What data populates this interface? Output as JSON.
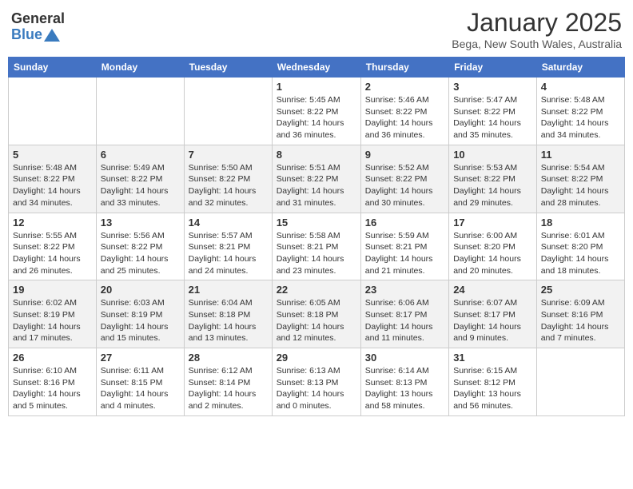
{
  "header": {
    "logo_general": "General",
    "logo_blue": "Blue",
    "month": "January 2025",
    "location": "Bega, New South Wales, Australia"
  },
  "weekdays": [
    "Sunday",
    "Monday",
    "Tuesday",
    "Wednesday",
    "Thursday",
    "Friday",
    "Saturday"
  ],
  "weeks": [
    [
      {
        "day": "",
        "info": ""
      },
      {
        "day": "",
        "info": ""
      },
      {
        "day": "",
        "info": ""
      },
      {
        "day": "1",
        "info": "Sunrise: 5:45 AM\nSunset: 8:22 PM\nDaylight: 14 hours\nand 36 minutes."
      },
      {
        "day": "2",
        "info": "Sunrise: 5:46 AM\nSunset: 8:22 PM\nDaylight: 14 hours\nand 36 minutes."
      },
      {
        "day": "3",
        "info": "Sunrise: 5:47 AM\nSunset: 8:22 PM\nDaylight: 14 hours\nand 35 minutes."
      },
      {
        "day": "4",
        "info": "Sunrise: 5:48 AM\nSunset: 8:22 PM\nDaylight: 14 hours\nand 34 minutes."
      }
    ],
    [
      {
        "day": "5",
        "info": "Sunrise: 5:48 AM\nSunset: 8:22 PM\nDaylight: 14 hours\nand 34 minutes."
      },
      {
        "day": "6",
        "info": "Sunrise: 5:49 AM\nSunset: 8:22 PM\nDaylight: 14 hours\nand 33 minutes."
      },
      {
        "day": "7",
        "info": "Sunrise: 5:50 AM\nSunset: 8:22 PM\nDaylight: 14 hours\nand 32 minutes."
      },
      {
        "day": "8",
        "info": "Sunrise: 5:51 AM\nSunset: 8:22 PM\nDaylight: 14 hours\nand 31 minutes."
      },
      {
        "day": "9",
        "info": "Sunrise: 5:52 AM\nSunset: 8:22 PM\nDaylight: 14 hours\nand 30 minutes."
      },
      {
        "day": "10",
        "info": "Sunrise: 5:53 AM\nSunset: 8:22 PM\nDaylight: 14 hours\nand 29 minutes."
      },
      {
        "day": "11",
        "info": "Sunrise: 5:54 AM\nSunset: 8:22 PM\nDaylight: 14 hours\nand 28 minutes."
      }
    ],
    [
      {
        "day": "12",
        "info": "Sunrise: 5:55 AM\nSunset: 8:22 PM\nDaylight: 14 hours\nand 26 minutes."
      },
      {
        "day": "13",
        "info": "Sunrise: 5:56 AM\nSunset: 8:22 PM\nDaylight: 14 hours\nand 25 minutes."
      },
      {
        "day": "14",
        "info": "Sunrise: 5:57 AM\nSunset: 8:21 PM\nDaylight: 14 hours\nand 24 minutes."
      },
      {
        "day": "15",
        "info": "Sunrise: 5:58 AM\nSunset: 8:21 PM\nDaylight: 14 hours\nand 23 minutes."
      },
      {
        "day": "16",
        "info": "Sunrise: 5:59 AM\nSunset: 8:21 PM\nDaylight: 14 hours\nand 21 minutes."
      },
      {
        "day": "17",
        "info": "Sunrise: 6:00 AM\nSunset: 8:20 PM\nDaylight: 14 hours\nand 20 minutes."
      },
      {
        "day": "18",
        "info": "Sunrise: 6:01 AM\nSunset: 8:20 PM\nDaylight: 14 hours\nand 18 minutes."
      }
    ],
    [
      {
        "day": "19",
        "info": "Sunrise: 6:02 AM\nSunset: 8:19 PM\nDaylight: 14 hours\nand 17 minutes."
      },
      {
        "day": "20",
        "info": "Sunrise: 6:03 AM\nSunset: 8:19 PM\nDaylight: 14 hours\nand 15 minutes."
      },
      {
        "day": "21",
        "info": "Sunrise: 6:04 AM\nSunset: 8:18 PM\nDaylight: 14 hours\nand 13 minutes."
      },
      {
        "day": "22",
        "info": "Sunrise: 6:05 AM\nSunset: 8:18 PM\nDaylight: 14 hours\nand 12 minutes."
      },
      {
        "day": "23",
        "info": "Sunrise: 6:06 AM\nSunset: 8:17 PM\nDaylight: 14 hours\nand 11 minutes."
      },
      {
        "day": "24",
        "info": "Sunrise: 6:07 AM\nSunset: 8:17 PM\nDaylight: 14 hours\nand 9 minutes."
      },
      {
        "day": "25",
        "info": "Sunrise: 6:09 AM\nSunset: 8:16 PM\nDaylight: 14 hours\nand 7 minutes."
      }
    ],
    [
      {
        "day": "26",
        "info": "Sunrise: 6:10 AM\nSunset: 8:16 PM\nDaylight: 14 hours\nand 5 minutes."
      },
      {
        "day": "27",
        "info": "Sunrise: 6:11 AM\nSunset: 8:15 PM\nDaylight: 14 hours\nand 4 minutes."
      },
      {
        "day": "28",
        "info": "Sunrise: 6:12 AM\nSunset: 8:14 PM\nDaylight: 14 hours\nand 2 minutes."
      },
      {
        "day": "29",
        "info": "Sunrise: 6:13 AM\nSunset: 8:13 PM\nDaylight: 14 hours\nand 0 minutes."
      },
      {
        "day": "30",
        "info": "Sunrise: 6:14 AM\nSunset: 8:13 PM\nDaylight: 13 hours\nand 58 minutes."
      },
      {
        "day": "31",
        "info": "Sunrise: 6:15 AM\nSunset: 8:12 PM\nDaylight: 13 hours\nand 56 minutes."
      },
      {
        "day": "",
        "info": ""
      }
    ]
  ]
}
